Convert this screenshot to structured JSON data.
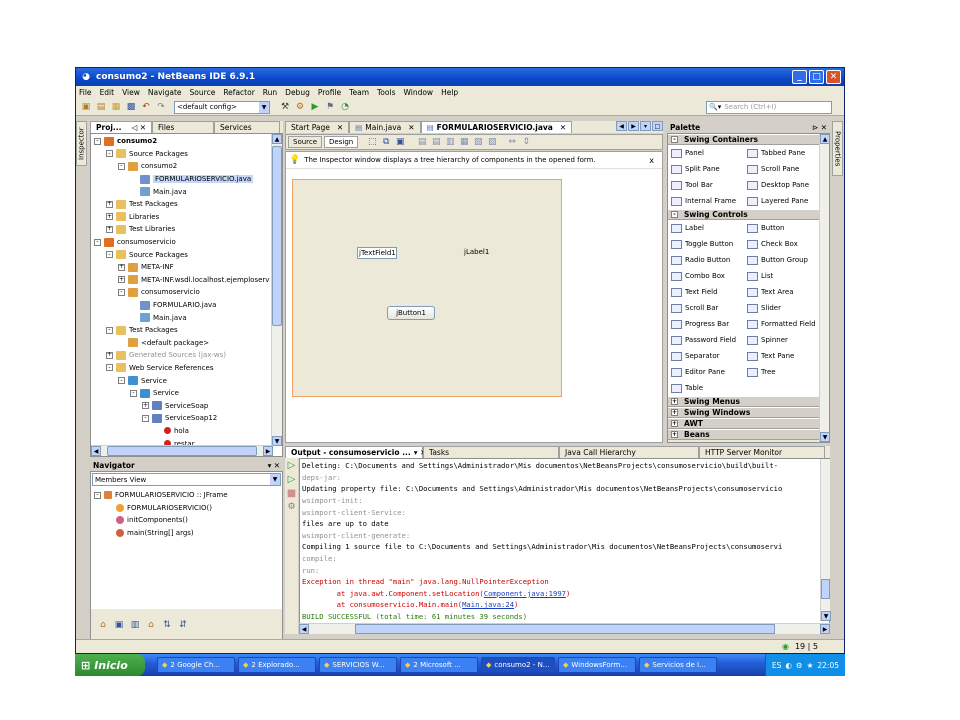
{
  "window": {
    "title": "consumo2 - NetBeans IDE 6.9.1"
  },
  "menu": [
    "File",
    "Edit",
    "View",
    "Navigate",
    "Source",
    "Refactor",
    "Run",
    "Debug",
    "Profile",
    "Team",
    "Tools",
    "Window",
    "Help"
  ],
  "toolbar": {
    "config_value": "<default config>",
    "search_placeholder": "Search (Ctrl+I)"
  },
  "projects": {
    "tabs": [
      "Proj...",
      "Files",
      "Services"
    ],
    "tree": [
      {
        "indent": 0,
        "exp": "-",
        "icon": "project",
        "label": "consumo2",
        "bold": true
      },
      {
        "indent": 1,
        "exp": "-",
        "icon": "folder",
        "label": "Source Packages"
      },
      {
        "indent": 2,
        "exp": "-",
        "icon": "package",
        "label": "consumo2"
      },
      {
        "indent": 3,
        "exp": "",
        "icon": "form",
        "label": "FORMULARIOSERVICIO.java",
        "sel": true
      },
      {
        "indent": 3,
        "exp": "",
        "icon": "java",
        "label": "Main.java"
      },
      {
        "indent": 1,
        "exp": "+",
        "icon": "folder",
        "label": "Test Packages"
      },
      {
        "indent": 1,
        "exp": "+",
        "icon": "folder",
        "label": "Libraries"
      },
      {
        "indent": 1,
        "exp": "+",
        "icon": "folder",
        "label": "Test Libraries"
      },
      {
        "indent": 0,
        "exp": "-",
        "icon": "project",
        "label": "consumoservicio"
      },
      {
        "indent": 1,
        "exp": "-",
        "icon": "folder",
        "label": "Source Packages"
      },
      {
        "indent": 2,
        "exp": "+",
        "icon": "package",
        "label": "META-INF"
      },
      {
        "indent": 2,
        "exp": "+",
        "icon": "package",
        "label": "META-INF.wsdl.localhost.ejemploserv"
      },
      {
        "indent": 2,
        "exp": "-",
        "icon": "package",
        "label": "consumoservicio"
      },
      {
        "indent": 3,
        "exp": "",
        "icon": "form",
        "label": "FORMULARIO.java"
      },
      {
        "indent": 3,
        "exp": "",
        "icon": "java",
        "label": "Main.java"
      },
      {
        "indent": 1,
        "exp": "-",
        "icon": "folder",
        "label": "Test Packages"
      },
      {
        "indent": 2,
        "exp": "",
        "icon": "package",
        "label": "<default package>"
      },
      {
        "indent": 1,
        "exp": "+",
        "icon": "folder",
        "label": "Generated Sources (jax-ws)",
        "gray": true
      },
      {
        "indent": 1,
        "exp": "-",
        "icon": "folder",
        "label": "Web Service References"
      },
      {
        "indent": 2,
        "exp": "-",
        "icon": "service",
        "label": "Service"
      },
      {
        "indent": 3,
        "exp": "-",
        "icon": "service",
        "label": "Service"
      },
      {
        "indent": 4,
        "exp": "+",
        "icon": "port",
        "label": "ServiceSoap"
      },
      {
        "indent": 4,
        "exp": "-",
        "icon": "port",
        "label": "ServiceSoap12"
      },
      {
        "indent": 5,
        "exp": "",
        "icon": "op",
        "label": "hola"
      },
      {
        "indent": 5,
        "exp": "",
        "icon": "op",
        "label": "restar"
      }
    ]
  },
  "navigator": {
    "title": "Navigator",
    "view": "Members View",
    "items": [
      {
        "indent": 0,
        "exp": "-",
        "label": "FORMULARIOSERVICIO :: JFrame"
      },
      {
        "indent": 1,
        "exp": "",
        "label": "FORMULARIOSERVICIO()"
      },
      {
        "indent": 1,
        "exp": "",
        "label": "initComponents()"
      },
      {
        "indent": 1,
        "exp": "",
        "label": "main(String[] args)"
      }
    ]
  },
  "editor": {
    "tabs": [
      "Start Page",
      "Main.java",
      "FORMULARIOSERVICIO.java"
    ],
    "mode_tabs": [
      "Source",
      "Design"
    ],
    "hint": "The Inspector window displays a tree hierarchy of components in the opened form.",
    "hint_close": "x",
    "components": {
      "textfield": "jTextField1",
      "label": "jLabel1",
      "button": "jButton1"
    }
  },
  "palette": {
    "title": "Palette",
    "sections": [
      {
        "name": "Swing Containers",
        "exp": "-",
        "items": [
          "Panel",
          "Tabbed Pane",
          "Split Pane",
          "Scroll Pane",
          "Tool Bar",
          "Desktop Pane",
          "Internal Frame",
          "Layered Pane"
        ]
      },
      {
        "name": "Swing Controls",
        "exp": "-",
        "items": [
          "Label",
          "Button",
          "Toggle Button",
          "Check Box",
          "Radio Button",
          "Button Group",
          "Combo Box",
          "List",
          "Text Field",
          "Text Area",
          "Scroll Bar",
          "Slider",
          "Progress Bar",
          "Formatted Field",
          "Password Field",
          "Spinner",
          "Separator",
          "Text Pane",
          "Editor Pane",
          "Tree",
          "Table"
        ]
      },
      {
        "name": "Swing Menus",
        "exp": "+",
        "items": []
      },
      {
        "name": "Swing Windows",
        "exp": "+",
        "items": []
      },
      {
        "name": "AWT",
        "exp": "+",
        "items": []
      },
      {
        "name": "Beans",
        "exp": "+",
        "items": []
      }
    ]
  },
  "side_tabs": {
    "left": "Inspector",
    "right": "Properties"
  },
  "output": {
    "tabs": [
      "Output - consumoservicio ...",
      "Tasks",
      "Java Call Hierarchy",
      "HTTP Server Monitor"
    ],
    "lines": [
      {
        "t": "Deleting: C:\\Documents and Settings\\Administrador\\Mis documentos\\NetBeansProjects\\consumoservicio\\build\\built-",
        "c": "normal"
      },
      {
        "t": "deps-jar:",
        "c": "gray"
      },
      {
        "t": "Updating property file: C:\\Documents and Settings\\Administrador\\Mis documentos\\NetBeansProjects\\consumoservicio",
        "c": "normal"
      },
      {
        "t": "wsimport-init:",
        "c": "gray"
      },
      {
        "t": "wsimport-client-Service:",
        "c": "gray"
      },
      {
        "t": "files are up to date",
        "c": "normal"
      },
      {
        "t": "wsimport-client-generate:",
        "c": "gray"
      },
      {
        "t": "Compiling 1 source file to C:\\Documents and Settings\\Administrador\\Mis documentos\\NetBeansProjects\\consumoservi",
        "c": "normal"
      },
      {
        "t": "compile:",
        "c": "gray"
      },
      {
        "t": "run:",
        "c": "gray"
      },
      {
        "t": "Exception in thread \"main\" java.lang.NullPointerException",
        "c": "red"
      },
      {
        "t": "        at java.awt.Component.setLocation(",
        "link": "Component.java:1997",
        "tail": ")",
        "c": "red"
      },
      {
        "t": "        at consumoservicio.Main.main(",
        "link": "Main.java:24",
        "tail": ")",
        "c": "red"
      },
      {
        "t": "BUILD SUCCESSFUL (total time: 61 minutes 39 seconds)",
        "c": "green"
      }
    ]
  },
  "status": {
    "position": "19 | 5"
  },
  "taskbar": {
    "start": "Inicio",
    "items": [
      "2 Google Ch...",
      "2 Explorado...",
      "SERVICIOS W...",
      "2 Microsoft ...",
      "consumo2 - N...",
      "WindowsForm...",
      "Servicios de I..."
    ],
    "lang": "ES",
    "clock": "22:05"
  },
  "colors": {
    "title_bar": "#0a48c8",
    "taskbar": "#245edb",
    "start": "#3c9a3c",
    "selection": "#c4d7f6",
    "output_red": "#cc0000",
    "output_green": "#2b7a0b",
    "output_gray": "#909090"
  }
}
